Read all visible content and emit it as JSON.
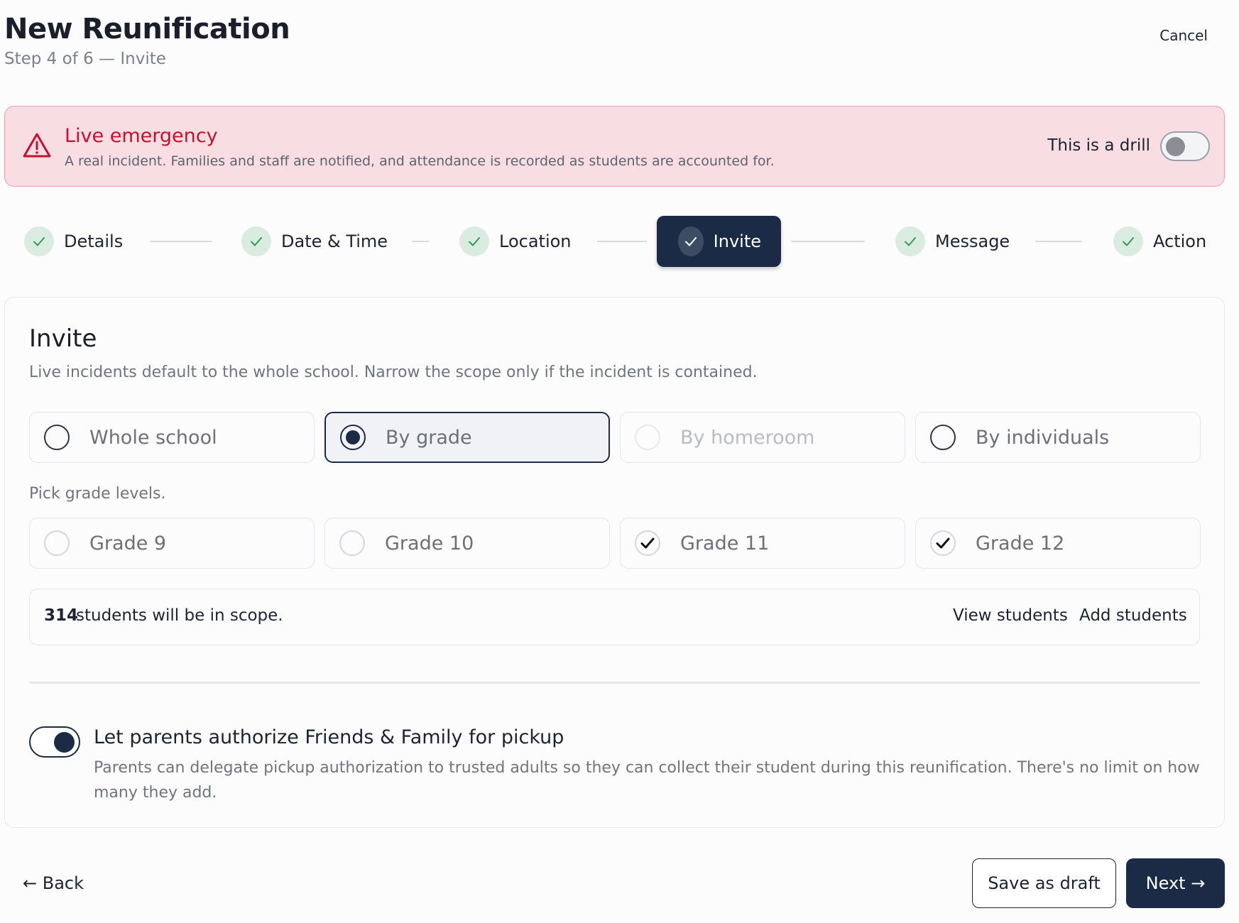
{
  "header": {
    "title": "New Reunification",
    "subtitle": "Step 4 of 6 — Invite",
    "cancel_label": "Cancel"
  },
  "banner": {
    "title": "Live emergency",
    "text": "A real incident. Families and staff are notified, and attendance is recorded as students are accounted for.",
    "drill_label": "This is a drill",
    "drill_on": false,
    "icon": "warning-triangle-icon",
    "accent_color": "#c8102e"
  },
  "stepper": {
    "steps": [
      {
        "label": "Details",
        "complete": true
      },
      {
        "label": "Date & Time",
        "complete": true
      },
      {
        "label": "Location",
        "complete": true
      },
      {
        "label": "Invite",
        "complete": true,
        "active": true
      },
      {
        "label": "Message",
        "complete": true
      },
      {
        "label": "Action",
        "complete": true
      }
    ]
  },
  "invite": {
    "title": "Invite",
    "description": "Live incidents default to the whole school. Narrow the scope only if the incident is contained.",
    "scope_options": [
      {
        "label": "Whole school",
        "selected": false,
        "disabled": false
      },
      {
        "label": "By grade",
        "selected": true,
        "disabled": false
      },
      {
        "label": "By homeroom",
        "selected": false,
        "disabled": true
      },
      {
        "label": "By individuals",
        "selected": false,
        "disabled": false
      }
    ],
    "grade_prompt": "Pick grade levels.",
    "grades": [
      {
        "label": "Grade 9",
        "checked": false
      },
      {
        "label": "Grade 10",
        "checked": false
      },
      {
        "label": "Grade 11",
        "checked": true
      },
      {
        "label": "Grade 12",
        "checked": true
      }
    ],
    "scope_count": "314",
    "scope_text": "students will be in scope.",
    "view_students_label": "View students",
    "add_students_label": "Add students",
    "pickup": {
      "enabled": true,
      "title": "Let parents authorize Friends & Family for pickup",
      "description": "Parents can delegate pickup authorization to trusted adults so they can collect their student during this reunification. There's no limit on how many they add."
    }
  },
  "footer": {
    "back_label": "← Back",
    "save_draft_label": "Save as draft",
    "next_label": "Next →"
  },
  "colors": {
    "primary": "#1c2b45",
    "success_check": "#2f9e52",
    "banner_bg": "#f8dde2"
  }
}
